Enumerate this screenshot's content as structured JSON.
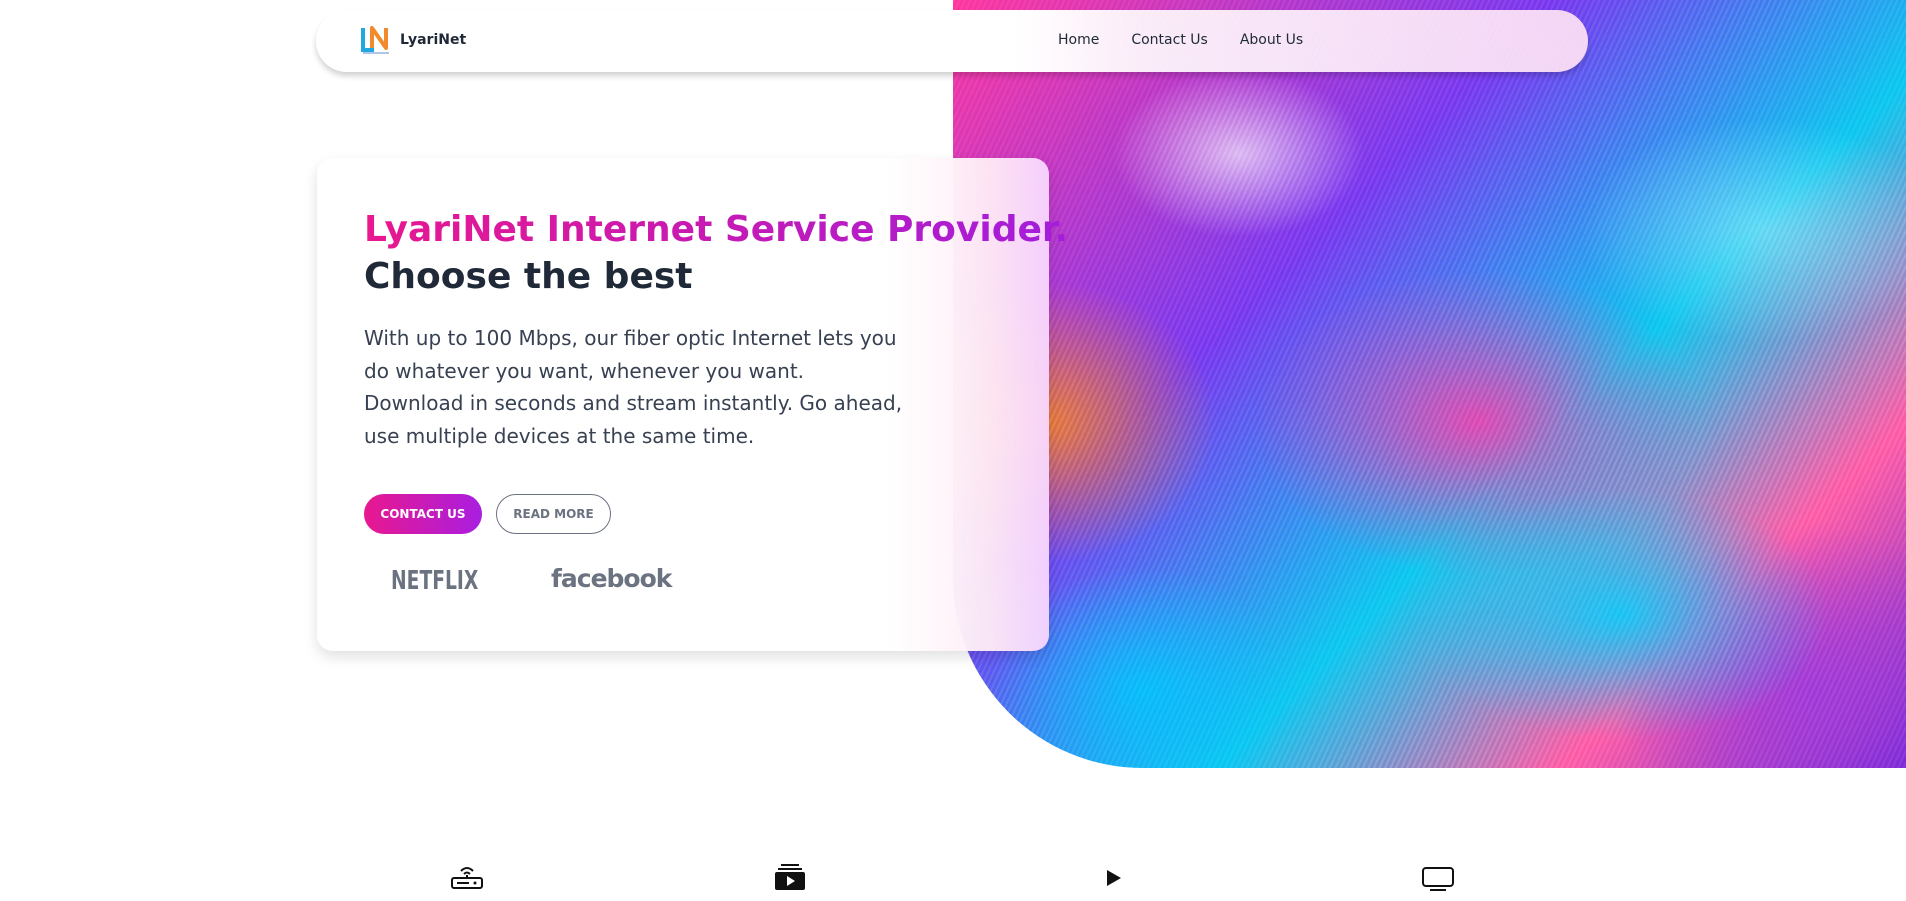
{
  "navbar": {
    "brand": "LyariNet",
    "links": [
      {
        "label": "Home"
      },
      {
        "label": "Contact Us"
      },
      {
        "label": "About Us"
      }
    ]
  },
  "hero": {
    "title_highlight": "LyariNet Internet Service Provider.",
    "title_rest": "Choose the best",
    "description": "With up to 100 Mbps, our fiber optic Internet lets you do whatever you want, whenever you want. Download in seconds and stream instantly. Go ahead, use multiple devices at the same time.",
    "primary_button": "CONTACT US",
    "secondary_button": "READ MORE",
    "partner_logos": [
      "NETFLIX",
      "facebook"
    ]
  },
  "features": {
    "icons": [
      "router-icon",
      "video-player-icon",
      "play-icon",
      "tv-icon"
    ]
  },
  "colors": {
    "accent_start": "#e8188f",
    "accent_end": "#a31ddb",
    "text_dark": "#1f2937",
    "muted": "#6b7280"
  }
}
